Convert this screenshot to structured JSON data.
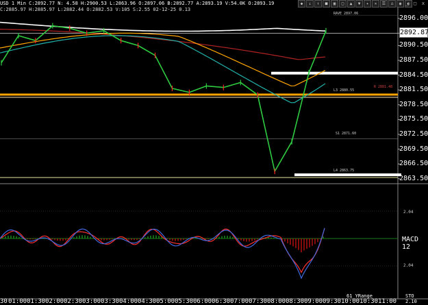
{
  "header": {
    "line1": "USD 1 Min C:2892.77 N: 4.58 H:2900.53 L:2863.96 O:2897.06 B:2892.77 A:2893.19 V:54.0K O:2893.19",
    "line2": "C:2885.97 H:2885.97 L:2882.44 O:2882.53 V:105 S:2.55 02-12-25 0.13"
  },
  "toolbar": {
    "buttons": [
      "◆",
      "↓",
      "↑",
      "■",
      "▣",
      "□",
      "▲",
      "▼",
      "✦",
      "✕",
      "☰",
      "⌂",
      "◉",
      "◐"
    ]
  },
  "window": {
    "min": "_",
    "max": "□",
    "close": "x"
  },
  "price_axis": {
    "labels": [
      "2896.00",
      "2893.00",
      "2890.50",
      "2887.50",
      "2884.50",
      "2881.50",
      "2878.50",
      "2875.50",
      "2872.50",
      "2869.50",
      "2866.50",
      "2863.50"
    ],
    "current": "2892.87"
  },
  "levels": {
    "r_avg": "RAVE 2897.06",
    "l3": "L3 2880.55",
    "s1": "S1 2871.60",
    "l4": "L4 2863.75",
    "right_tag": "R 2881.48"
  },
  "indicator_axis": {
    "upper": "2.04",
    "lower": "2.04"
  },
  "macd_label": "MACD 12",
  "stoch_label": "STO 2.10",
  "yrange_label": "61 YRange",
  "time_axis": {
    "labels": [
      "01:00",
      "01:30",
      "02:00",
      "02:30",
      "03:00",
      "03:30",
      "04:00",
      "04:30",
      "05:00",
      "05:30",
      "06:00",
      "06:30",
      "07:00",
      "07:30",
      "08:00",
      "08:30",
      "09:00",
      "09:30",
      "10:00",
      "10:30",
      "11:00"
    ],
    "first_prefix": "30"
  },
  "chart_data": {
    "type": "line",
    "title": "",
    "ylim": [
      2862.5,
      2897.5
    ],
    "x": [
      "01:00",
      "01:30",
      "02:00",
      "02:30",
      "03:00",
      "03:30",
      "04:00",
      "04:30",
      "05:00",
      "05:30",
      "06:00",
      "06:30",
      "07:00",
      "07:30",
      "08:00",
      "08:15",
      "08:30",
      "08:45",
      "09:00",
      "09:15"
    ],
    "series": [
      {
        "values": [
          2887.0,
          2892.5,
          2891.5,
          2894.5,
          2894.0,
          2893.0,
          2893.5,
          2891.5,
          2890.5,
          2888.5,
          2881.8,
          2881.0,
          2882.3,
          2882.0,
          2883.0,
          2880.5,
          2865.0,
          2871.0,
          2885.0,
          2893.5
        ]
      }
    ],
    "levels": [
      2897.06,
      2893.0,
      2884.9,
      2880.55,
      2871.6,
      2864.3,
      2863.75
    ],
    "colors": {
      "price": "#2ecc40",
      "down": "#ff2020",
      "ma_white": "#ffffff",
      "ma_red": "#b22222",
      "ma_orange": "#ffa500",
      "ma_cyan": "#20b2aa",
      "macd_blue": "#4169e1",
      "macd_red": "#ff3030"
    }
  }
}
